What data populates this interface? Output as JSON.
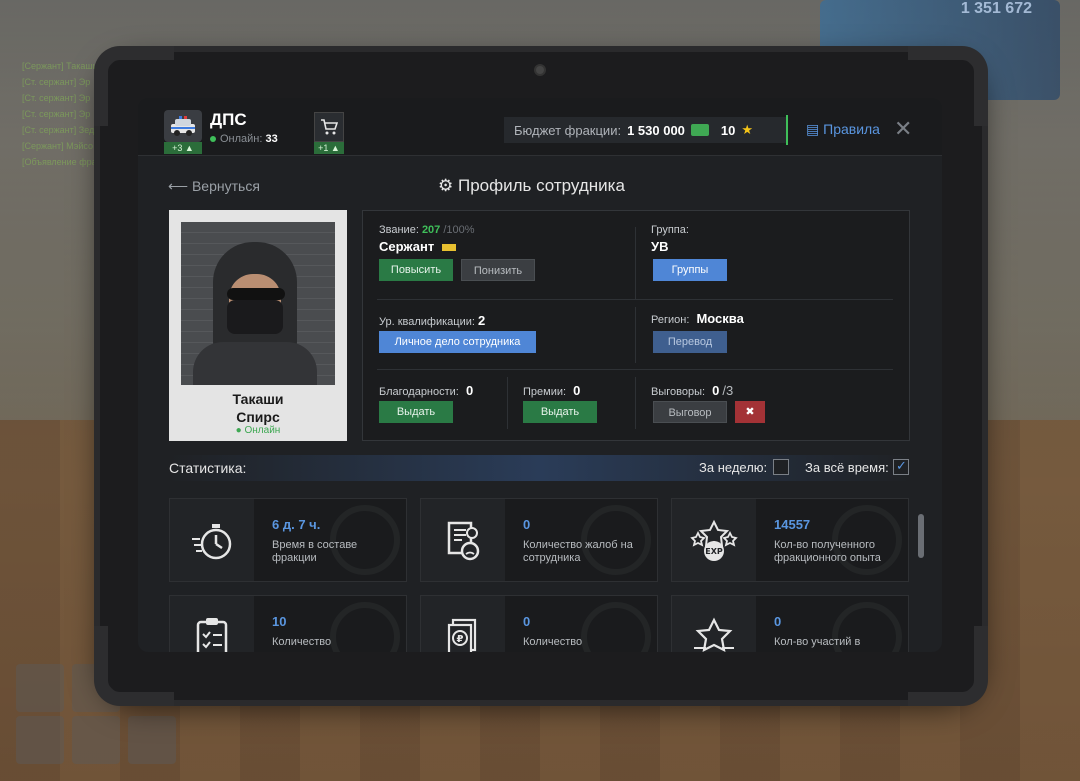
{
  "background": {
    "chat_lines": [
      "[Сержант] Такаши",
      "[Ст. сержант] Эр",
      "[Ст. сержант] Эр",
      "[Ст. сержант] Эр",
      "[Ст. сержант] Зед",
      "[Сержант] Мэйсо",
      "[Объявление фракции]"
    ],
    "money": "1 351 672"
  },
  "header": {
    "faction_name": "ДПС",
    "online_label": "Онлайн:",
    "online_count": "33",
    "faction_badge": "+3",
    "cart_badge": "+1",
    "budget_label": "Бюджет фракции:",
    "budget_value": "1 530 000",
    "points_value": "10",
    "rules_label": "Правила",
    "close_label": "✕"
  },
  "nav": {
    "back_label": "Вернуться",
    "title": "Профиль сотрудника"
  },
  "employee": {
    "first_name": "Такаши",
    "last_name": "Спирс",
    "status": "Онлайн"
  },
  "info": {
    "rank_label": "Звание:",
    "rank_points": "207",
    "rank_max": "/100%",
    "rank_name": "Сержант",
    "promote_button": "Повысить",
    "demote_button": "Понизить",
    "group_label": "Группа:",
    "group_value": "УВ",
    "groups_button": "Группы",
    "qualification_label": "Ур. квалификации:",
    "qualification_value": "2",
    "personal_file_button": "Личное дело сотрудника",
    "region_label": "Регион:",
    "region_value": "Москва",
    "transfer_button": "Перевод",
    "thanks_label": "Благодарности:",
    "thanks_value": "0",
    "thanks_button": "Выдать",
    "bonus_label": "Премии:",
    "bonus_value": "0",
    "bonus_button": "Выдать",
    "reprimand_label": "Выговоры:",
    "reprimand_value": "0",
    "reprimand_max": "/3",
    "reprimand_button": "Выговор"
  },
  "statistics": {
    "title": "Статистика:",
    "week_label": "За неделю:",
    "alltime_label": "За всё время:",
    "week_checked": false,
    "alltime_checked": true,
    "cards": [
      {
        "value": "6 д. 7 ч.",
        "desc": "Время в составе фракции",
        "icon": "stopwatch-icon"
      },
      {
        "value": "0",
        "desc": "Количество жалоб на сотрудника",
        "icon": "complaint-document-icon"
      },
      {
        "value": "14557",
        "desc": "Кол-во полученного фракционного опыта",
        "icon": "exp-stars-icon"
      },
      {
        "value": "10",
        "desc": "Количество",
        "icon": "clipboard-checklist-icon"
      },
      {
        "value": "0",
        "desc": "Количество",
        "icon": "ruble-documents-icon"
      },
      {
        "value": "0",
        "desc": "Кол-во участий в",
        "icon": "star-icon"
      }
    ]
  },
  "colors": {
    "accent_blue": "#5a96e0",
    "accent_green": "#2a7a45",
    "online_green": "#3fbf5a",
    "danger_red": "#a33236"
  }
}
